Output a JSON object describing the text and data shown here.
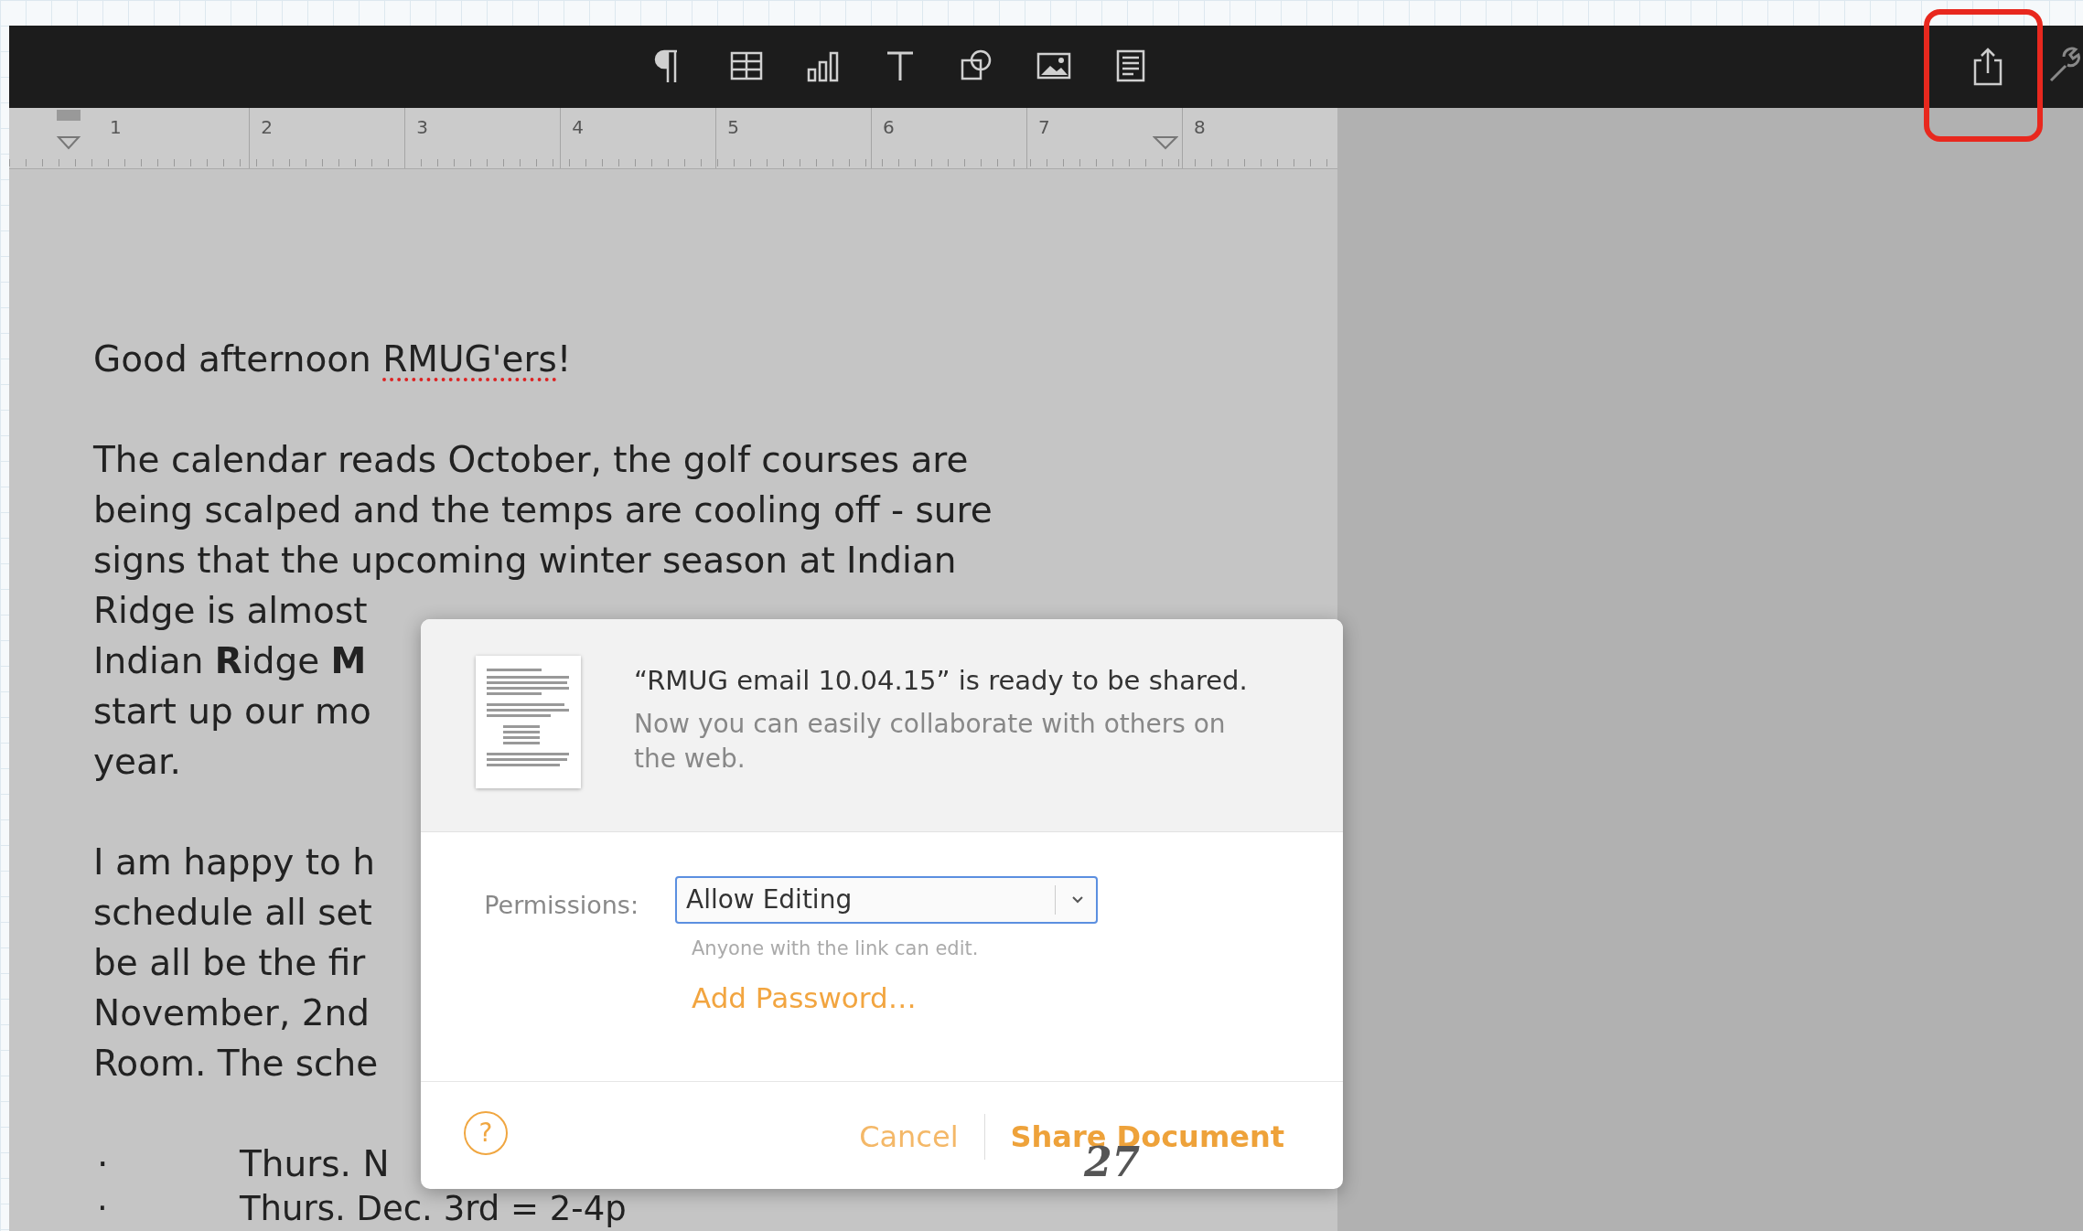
{
  "ruler": {
    "labels": [
      "1",
      "2",
      "3",
      "4",
      "5",
      "6",
      "7",
      "8"
    ]
  },
  "document": {
    "heading": [
      {
        "text": "Good afternoon ",
        "misspelled": false
      },
      {
        "text": "RMUG'ers",
        "misspelled": true
      },
      {
        "text": "!",
        "misspelled": false
      }
    ],
    "paragraphs": [
      {
        "lines": [
          "The calendar reads October, the golf courses are",
          "being scalped and the temps are cooling off - sure",
          "signs that the upcoming winter season at Indian",
          "Ridge is almost",
          "Indian **R**idge **M**",
          "start up our mo",
          "year."
        ]
      },
      {
        "lines": [
          "I am happy to h",
          "schedule all set",
          "be all be the fir",
          "November, 2nd",
          "Room. The sche"
        ]
      }
    ],
    "bullets": [
      {
        "marker": "·",
        "text": "Thurs. N"
      },
      {
        "marker": "·",
        "text": "Thurs. Dec. 3rd = 2-4p"
      }
    ]
  },
  "share_dialog": {
    "title": "“RMUG email 10.04.15” is ready to be shared.",
    "message": "Now you can easily collaborate with others on the web.",
    "permissions_label": "Permissions:",
    "permissions_value": "Allow Editing",
    "permissions_hint": "Anyone with the link can edit.",
    "add_password": "Add Password…",
    "help": "?",
    "buttons": [
      {
        "label": "Cancel",
        "primary": false
      },
      {
        "label": "Share Document",
        "primary": true
      }
    ]
  },
  "annotation": "27"
}
